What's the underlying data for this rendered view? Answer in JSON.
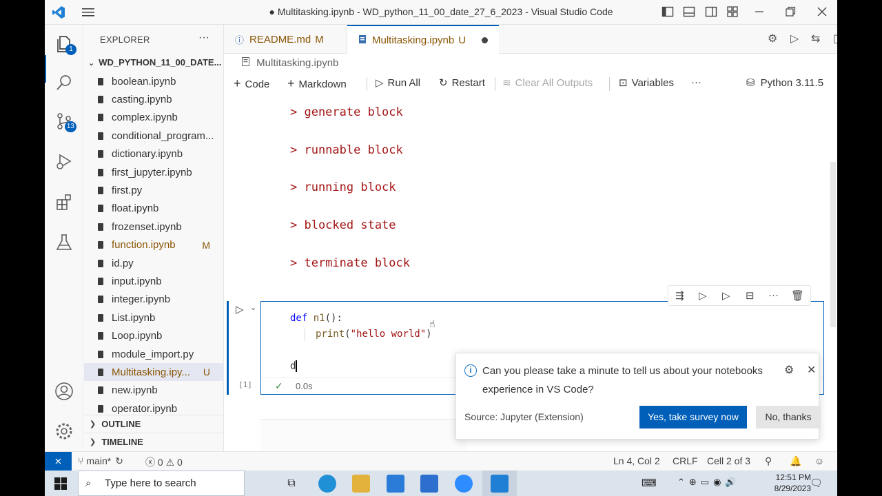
{
  "window": {
    "title": "● Multitasking.ipynb - WD_python_11_00_date_27_6_2023 - Visual Studio Code"
  },
  "activity_bar": {
    "explorer_badge": "1",
    "source_control_badge": "13"
  },
  "explorer": {
    "header": "EXPLORER",
    "folder": "WD_PYTHON_11_00_DATE...",
    "files": [
      {
        "name": "boolean.ipynb",
        "status": ""
      },
      {
        "name": "casting.ipynb",
        "status": ""
      },
      {
        "name": "complex.ipynb",
        "status": ""
      },
      {
        "name": "conditional_program...",
        "status": ""
      },
      {
        "name": "dictionary.ipynb",
        "status": ""
      },
      {
        "name": "first_jupyter.ipynb",
        "status": ""
      },
      {
        "name": "first.py",
        "status": ""
      },
      {
        "name": "float.ipynb",
        "status": ""
      },
      {
        "name": "frozenset.ipynb",
        "status": ""
      },
      {
        "name": "function.ipynb",
        "status": "M"
      },
      {
        "name": "id.py",
        "status": ""
      },
      {
        "name": "input.ipynb",
        "status": ""
      },
      {
        "name": "integer.ipynb",
        "status": ""
      },
      {
        "name": "List.ipynb",
        "status": ""
      },
      {
        "name": "Loop.ipynb",
        "status": ""
      },
      {
        "name": "module_import.py",
        "status": ""
      },
      {
        "name": "Multitasking.ipy...",
        "status": "U"
      },
      {
        "name": "new.ipynb",
        "status": ""
      },
      {
        "name": "operator.ipynb",
        "status": ""
      }
    ],
    "sections": [
      "OUTLINE",
      "TIMELINE"
    ]
  },
  "tabs": [
    {
      "label": "README.md",
      "status": "M"
    },
    {
      "label": "Multitasking.ipynb",
      "status": "U"
    }
  ],
  "breadcrumb": "Multitasking.ipynb",
  "notebook_toolbar": {
    "code": "Code",
    "markdown": "Markdown",
    "run_all": "Run All",
    "restart": "Restart",
    "clear_outputs": "Clear All Outputs",
    "variables": "Variables",
    "kernel": "Python 3.11.5"
  },
  "markdown_lines": [
    "> generate block",
    "> runnable block",
    "> running block",
    "> blocked state",
    "> terminate block"
  ],
  "cell": {
    "execution_count": "[1]",
    "duration": "0.0s",
    "code": {
      "def_kw": "def",
      "func_name": "n1",
      "def_rest": "():",
      "print_fn": "print",
      "open_paren": "(",
      "string": "\"hello world\"",
      "close_paren": ")",
      "typed": "d"
    }
  },
  "notification": {
    "message": "Can you please take a minute to tell us about your notebooks experience in VS Code?",
    "source": "Source: Jupyter (Extension)",
    "primary_button": "Yes, take survey now",
    "secondary_button": "No, thanks"
  },
  "status_bar": {
    "branch": "main*",
    "errors": "0",
    "warnings": "0",
    "position": "Ln 4, Col 2",
    "eol": "CRLF",
    "cell": "Cell 2 of 3"
  },
  "taskbar": {
    "search_placeholder": "Type here to search",
    "time": "12:51 PM",
    "date": "8/29/2023"
  },
  "colors": {
    "accent": "#005fb8",
    "modified": "#895503",
    "markdown_text": "#a31515"
  }
}
